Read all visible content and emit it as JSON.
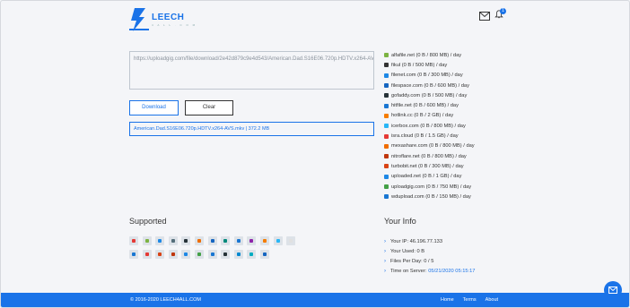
{
  "header": {
    "logo_name": "LEECH",
    "logo_sub": "4 A L L . C O M",
    "notification_count": "1"
  },
  "input": {
    "url": "https://uploadgig.com/file/download/2e42d879c9e4d543/American.Dad.S16E06.720p.HDTV.x264-AVS.mkv"
  },
  "buttons": {
    "download": "Download",
    "clear": "Clear"
  },
  "result": {
    "text": "American.Dad.S16E06.720p.HDTV.x264-AVS.mkv | 372.2 MB"
  },
  "hosts": [
    {
      "label": "alfafile.net (0 B / 800 MB) / day",
      "color": "#7cb342"
    },
    {
      "label": "fikul (0 B / 500 MB) / day",
      "color": "#333333"
    },
    {
      "label": "filenet.com (0 B / 300 MB) / day",
      "color": "#1e88e5"
    },
    {
      "label": "filespace.com (0 B / 600 MB) / day",
      "color": "#1565c0"
    },
    {
      "label": "gofaddy.com (0 B / 500 MB) / day",
      "color": "#263238"
    },
    {
      "label": "hitfile.net (0 B / 600 MB) / day",
      "color": "#1976d2"
    },
    {
      "label": "hotlink.cc (0 B / 2 GB) / day",
      "color": "#f57c00"
    },
    {
      "label": "icerbox.com (0 B / 800 MB) / day",
      "color": "#29b6f6"
    },
    {
      "label": "isra.cloud (0 B / 1.5 GB) / day",
      "color": "#e53935"
    },
    {
      "label": "mexashare.com (0 B / 800 MB) / day",
      "color": "#ef6c00"
    },
    {
      "label": "nitroflare.net (0 B / 800 MB) / day",
      "color": "#bf360c"
    },
    {
      "label": "turbobit.net (0 B / 300 MB) / day",
      "color": "#d84315"
    },
    {
      "label": "uploaded.net (0 B / 1 GB) / day",
      "color": "#1e88e5"
    },
    {
      "label": "uploadgig.com (0 B / 750 MB) / day",
      "color": "#43a047"
    },
    {
      "label": "wdupload.com (0 B / 150 MB) / day",
      "color": "#1976d2"
    }
  ],
  "supported": {
    "title": "Supported",
    "icon_colors": [
      "#e53935",
      "#7cb342",
      "#1e88e5",
      "#546e7a",
      "#263238",
      "#ef6c00",
      "#1565c0",
      "#00897b",
      "#1976d2",
      "#8e24aa",
      "#f57c00",
      "#29b6f6",
      "#e0e0e0",
      "#1976d2",
      "#e53935",
      "#d84315",
      "#bf360c",
      "#1e88e5",
      "#43a047",
      "#1976d2",
      "#263238",
      "#0288d1",
      "#00acc1",
      "#1565c0"
    ]
  },
  "info": {
    "title": "Your Info",
    "items": [
      {
        "label": "Your IP: 46.196.77.133",
        "value": ""
      },
      {
        "label": "Your Used: 0 B",
        "value": ""
      },
      {
        "label": "Files Per Day: 0 / 5",
        "value": ""
      },
      {
        "label": "Time on Server: ",
        "value": "05/21/2020 05:15:17"
      }
    ]
  },
  "footer": {
    "copyright": "© 2016-2020 LEECH4ALL.COM",
    "links": [
      "Home",
      "Terms",
      "About"
    ]
  },
  "colors": {
    "accent": "#1a73e8",
    "background": "#f4f5f8"
  }
}
